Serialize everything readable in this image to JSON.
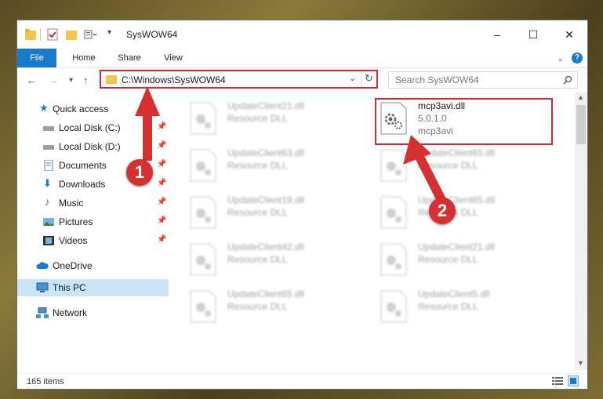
{
  "window": {
    "title": "SysWOW64",
    "controls": {
      "minimize": "–",
      "maximize": "☐",
      "close": "✕"
    }
  },
  "ribbon": {
    "tabs": [
      "File",
      "Home",
      "Share",
      "View"
    ],
    "help": "?"
  },
  "nav": {
    "address": "C:\\Windows\\SysWOW64",
    "search_placeholder": "Search SysWOW64"
  },
  "sidebar": {
    "items": [
      {
        "label": "Quick access",
        "icon": "star-icon",
        "pinned": false
      },
      {
        "label": "Local Disk (C:)",
        "icon": "drive-icon",
        "pinned": true
      },
      {
        "label": "Local Disk (D:)",
        "icon": "drive-icon",
        "pinned": true
      },
      {
        "label": "Documents",
        "icon": "documents-icon",
        "pinned": true
      },
      {
        "label": "Downloads",
        "icon": "download-icon",
        "pinned": true
      },
      {
        "label": "Music",
        "icon": "music-icon",
        "pinned": true
      },
      {
        "label": "Pictures",
        "icon": "pictures-icon",
        "pinned": true
      },
      {
        "label": "Videos",
        "icon": "videos-icon",
        "pinned": true
      },
      {
        "label": "OneDrive",
        "icon": "cloud-icon",
        "pinned": false
      },
      {
        "label": "This PC",
        "icon": "pc-icon",
        "pinned": false,
        "selected": true
      },
      {
        "label": "Network",
        "icon": "network-icon",
        "pinned": false
      }
    ]
  },
  "files": {
    "left": [
      {
        "name": "UpdateClient21.dll",
        "type": "Resource DLL"
      },
      {
        "name": "UpdateClient63.dll",
        "type": "Resource DLL"
      },
      {
        "name": "UpdateClient19.dll",
        "type": "Resource DLL"
      },
      {
        "name": "UpdateClient42.dll",
        "type": "Resource DLL"
      },
      {
        "name": "UpdateClient65.dll",
        "type": "Resource DLL"
      }
    ],
    "right": [
      {
        "name": "mcp3avi.dll",
        "type": "5.0.1.0",
        "desc": "mcp3avi",
        "highlighted": true
      },
      {
        "name": "UpdateClient65.dll",
        "type": "Resource DLL"
      },
      {
        "name": "UpdateClient65.dll",
        "type": "Resource DLL"
      },
      {
        "name": "UpdateClient21.dll",
        "type": "Resource DLL"
      },
      {
        "name": "UpdateClient5.dll",
        "type": "Resource DLL"
      }
    ]
  },
  "status": {
    "items_count": "165 items"
  },
  "callouts": [
    "1",
    "2"
  ],
  "colors": {
    "accent": "#1979ca",
    "highlight": "#d9262e",
    "callout": "#d63031"
  }
}
